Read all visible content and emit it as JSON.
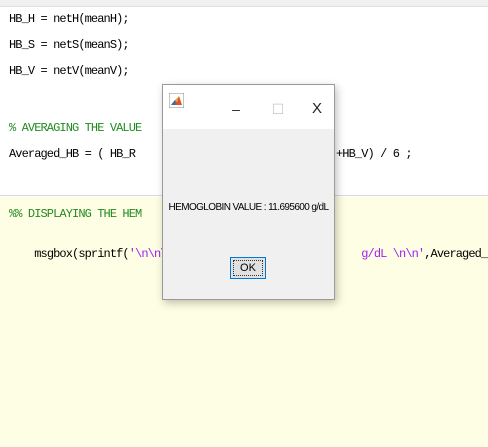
{
  "editor": {
    "lines": [
      "HB_H = netH(meanH);",
      "HB_S = netS(meanS);",
      "HB_V = netV(meanV);",
      "% AVERAGING THE VALUE",
      "Averaged_HB = ( HB_R",
      "+HB_V) / 6 ;",
      "%% DISPLAYING THE HEM",
      "msgbox(sprintf(",
      "'\\n\\n\\",
      "g/dL \\n\\n'",
      ",Averaged_HB))"
    ]
  },
  "dialog": {
    "minimize_glyph": "–",
    "maximize_glyph": "☐",
    "close_glyph": "X",
    "message": "HEMOGLOBIN VALUE : 11.695600 g/dL",
    "ok_label": "OK",
    "icon": "matlab-icon"
  },
  "colors": {
    "comment": "#228b22",
    "string": "#a020f0",
    "cell_highlight": "#fefee4",
    "button_focus": "#0078d7"
  }
}
